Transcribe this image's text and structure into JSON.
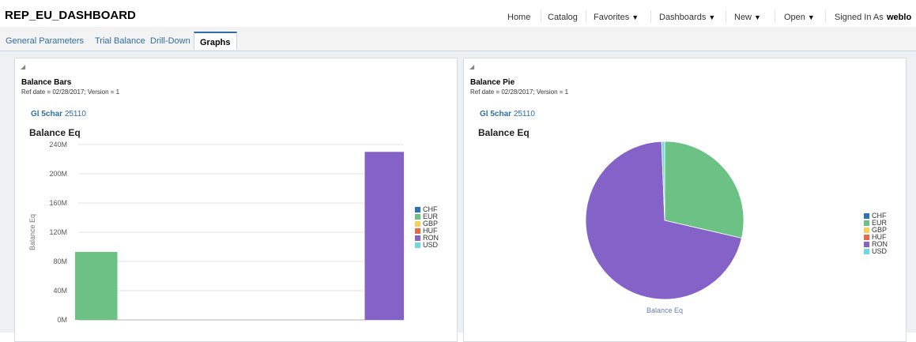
{
  "app": {
    "title": "REP_EU_DASHBOARD",
    "nav": {
      "home": "Home",
      "catalog": "Catalog",
      "favorites": "Favorites",
      "dashboards": "Dashboards",
      "new": "New",
      "open": "Open",
      "signed_in_label": "Signed In As",
      "signed_in_user": "weblo"
    }
  },
  "tabs": [
    {
      "label": "General Parameters"
    },
    {
      "label": "Trial Balance"
    },
    {
      "label": "Drill-Down"
    },
    {
      "label": "Graphs",
      "active": true
    }
  ],
  "panels": {
    "bars": {
      "title": "Balance Bars",
      "subtitle": "Ref date = 02/28/2017; Version = 1",
      "prompt_label": "Gl 5char",
      "prompt_value": "25110",
      "chart_title": "Balance Eq"
    },
    "pie": {
      "title": "Balance Pie",
      "subtitle": "Ref date = 02/28/2017; Version = 1",
      "prompt_label": "Gl 5char",
      "prompt_value": "25110",
      "chart_title": "Balance Eq",
      "caption": "Balance Eq"
    }
  },
  "colors": {
    "CHF": "#2a73b8",
    "EUR": "#6cc184",
    "GBP": "#f7cf59",
    "HUF": "#ea6a47",
    "RON": "#8562c7",
    "USD": "#6ddae2"
  },
  "chart_data": [
    {
      "type": "bar",
      "title": "Balance Eq",
      "ylabel": "Balance Eq",
      "xlabel": "",
      "ylim": [
        0,
        240000000
      ],
      "y_ticks": [
        "0M",
        "40M",
        "80M",
        "120M",
        "160M",
        "200M",
        "240M"
      ],
      "legend": [
        "CHF",
        "EUR",
        "GBP",
        "HUF",
        "RON",
        "USD"
      ],
      "legend_position": "right",
      "grid": true,
      "series": [
        {
          "name": "CHF",
          "values": [
            0,
            0
          ]
        },
        {
          "name": "EUR",
          "values": [
            93000000,
            0
          ]
        },
        {
          "name": "GBP",
          "values": [
            0,
            0
          ]
        },
        {
          "name": "HUF",
          "values": [
            0,
            0
          ]
        },
        {
          "name": "RON",
          "values": [
            0,
            230000000
          ]
        },
        {
          "name": "USD",
          "values": [
            0,
            2000000
          ]
        }
      ]
    },
    {
      "type": "pie",
      "title": "Balance Eq",
      "caption": "Balance Eq",
      "legend": [
        "CHF",
        "EUR",
        "GBP",
        "HUF",
        "RON",
        "USD"
      ],
      "legend_position": "right",
      "slices": [
        {
          "name": "CHF",
          "value": 0
        },
        {
          "name": "EUR",
          "value": 93000000
        },
        {
          "name": "GBP",
          "value": 0
        },
        {
          "name": "HUF",
          "value": 0
        },
        {
          "name": "RON",
          "value": 230000000
        },
        {
          "name": "USD",
          "value": 2000000
        }
      ]
    }
  ]
}
